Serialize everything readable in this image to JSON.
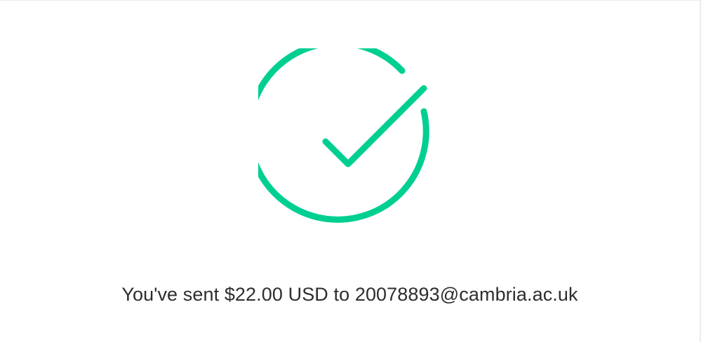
{
  "confirmation": {
    "message": "You've sent $22.00 USD to 20078893@cambria.ac.uk",
    "icon": "check-circle-icon",
    "accent_color": "#00cf92"
  }
}
